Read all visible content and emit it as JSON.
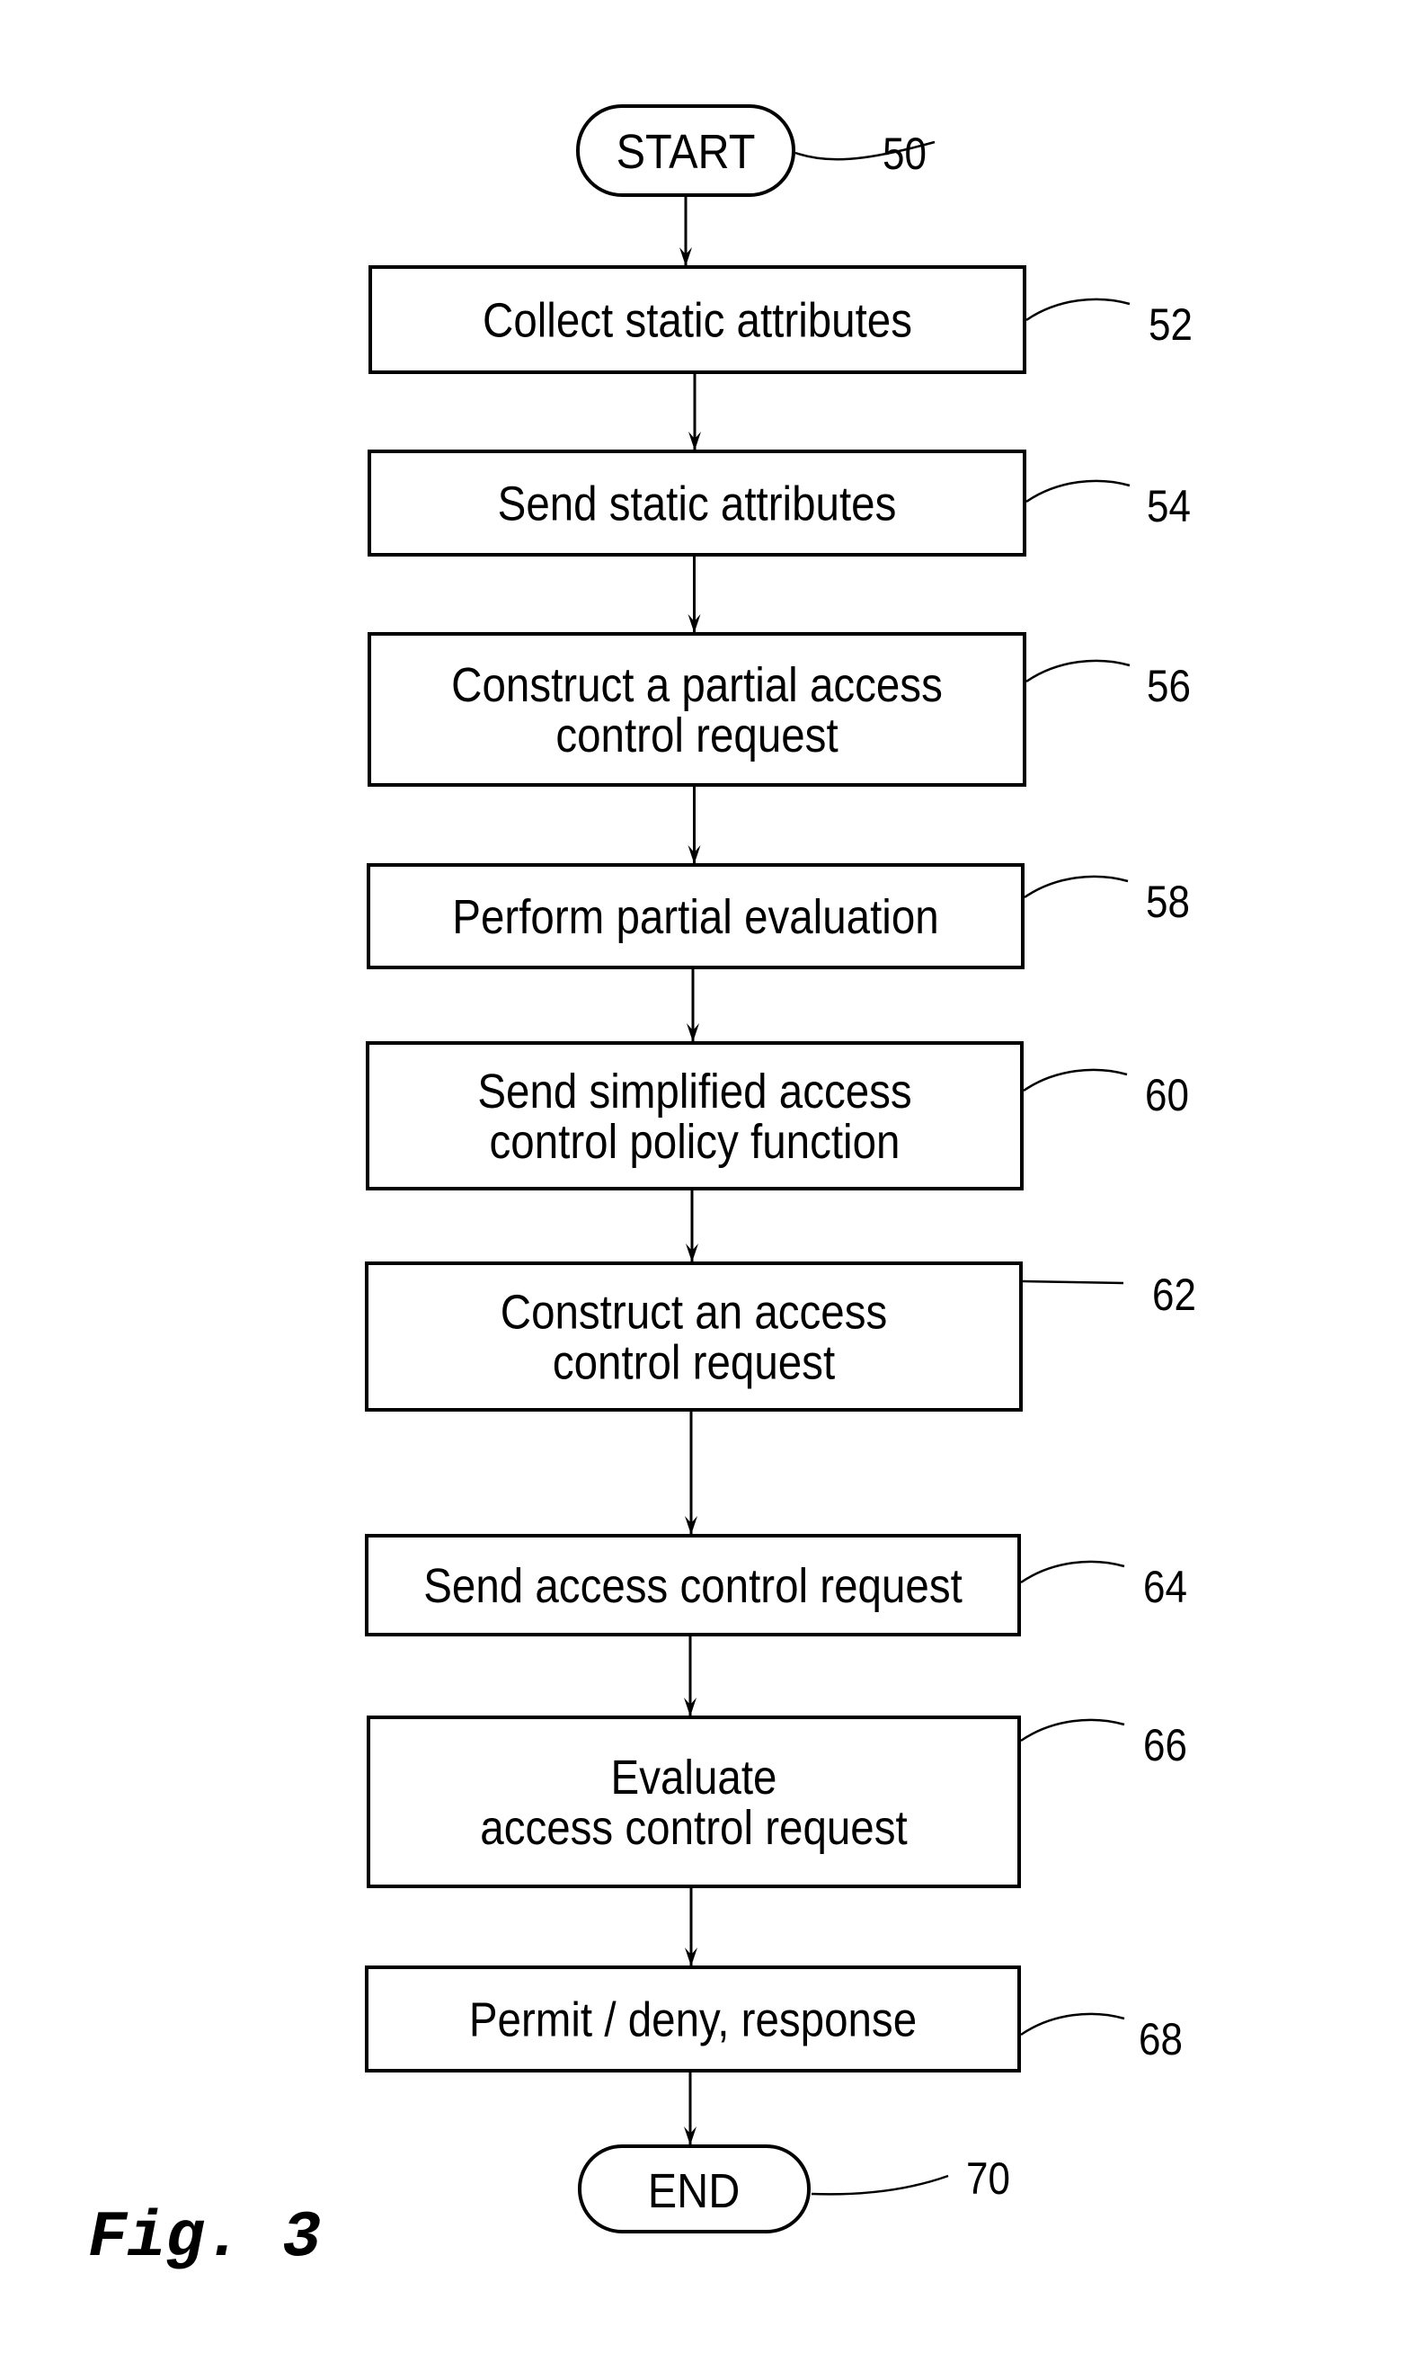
{
  "figure": {
    "caption": "Fig. 3",
    "start": {
      "label": "START",
      "ref": "50"
    },
    "end": {
      "label": "END",
      "ref": "70"
    },
    "steps": [
      {
        "ref": "52",
        "lines": [
          "Collect static attributes"
        ]
      },
      {
        "ref": "54",
        "lines": [
          "Send static attributes"
        ]
      },
      {
        "ref": "56",
        "lines": [
          "Construct a partial access",
          "control request"
        ]
      },
      {
        "ref": "58",
        "lines": [
          "Perform partial evaluation"
        ]
      },
      {
        "ref": "60",
        "lines": [
          "Send simplified access",
          "control policy function"
        ]
      },
      {
        "ref": "62",
        "lines": [
          "Construct an access",
          "control request"
        ]
      },
      {
        "ref": "64",
        "lines": [
          "Send access control request"
        ]
      },
      {
        "ref": "66",
        "lines": [
          "Evaluate",
          "access control request"
        ]
      },
      {
        "ref": "68",
        "lines": [
          "Permit / deny, response"
        ]
      }
    ]
  }
}
